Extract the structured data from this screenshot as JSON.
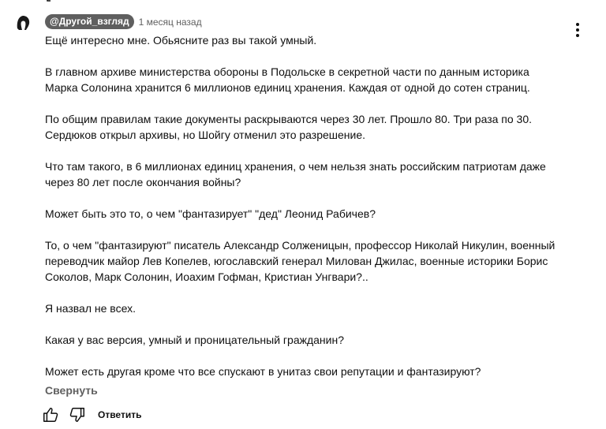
{
  "comment": {
    "author": "@Другой_взгляд",
    "timestamp": "1 месяц назад",
    "paragraphs": [
      "Ещё интересно мне. Обьясните раз вы такой умный.",
      "В главном архиве министерства обороны в Подольске в секретной части по данным историка\nМарка Солонина хранится 6 миллионов единиц хранения. Каждая от одной до сотен страниц.",
      "По общим правилам такие документы раскрываются через 30 лет. Прошло 80. Три раза по 30.\nСердюков открыл архивы, но Шойгу отменил это разрешение.",
      "Что там такого, в 6 миллионах единиц хранения, о чем нельзя знать российским патриотам даже\nчерез 80 лет после окончания войны?",
      "Может быть это то, о чем \"фантазирует\" \"дед\" Леонид Рабичев?",
      "То, о чем \"фантазируют\" писатель Александр Солженицын, профессор Николай Никулин, военный\nпереводчик майор Лев Копелев, югославский генерал Милован Джилас, военные историки Борис\nСоколов, Марк Солонин, Иоахим Гофман, Кристиан Унгвари?..",
      "Я назвал не всех.",
      "Какая у вас версия, умный и проницательный гражданин?",
      "Может есть другая кроме что все спускают в унитаз свои репутации и фантазируют?"
    ],
    "collapse_label": "Свернуть",
    "reply_label": "Ответить"
  },
  "icons": {
    "avatar": "avatar",
    "menu": "more-vert-icon",
    "like": "thumb-up-icon",
    "dislike": "thumb-down-icon"
  },
  "colors": {
    "author_chip_bg": "#5f5f5f",
    "text": "#0f0f0f",
    "secondary_text": "#606060"
  }
}
